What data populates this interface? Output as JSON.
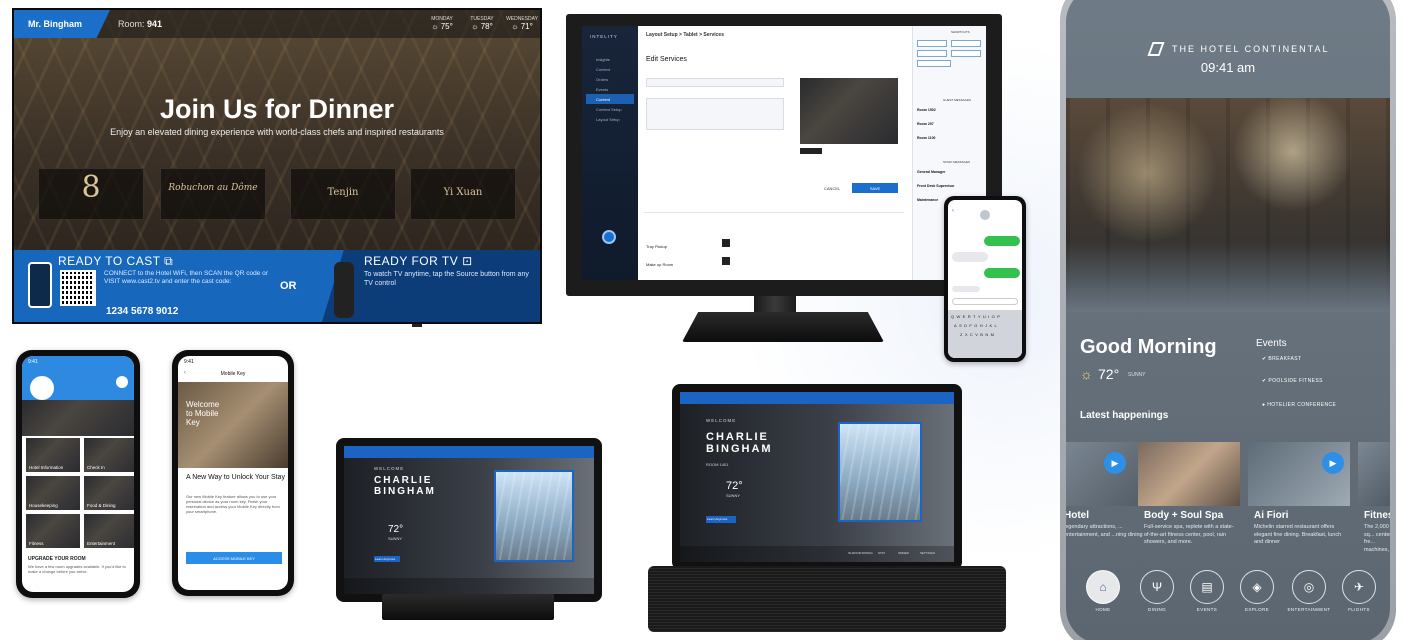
{
  "tv": {
    "guest": "Mr. Bingham",
    "room_label": "Room:",
    "room_number": "941",
    "weather": [
      {
        "day": "MONDAY",
        "temp": "75°"
      },
      {
        "day": "TUESDAY",
        "temp": "78°"
      },
      {
        "day": "WEDNESDAY",
        "temp": "71°"
      }
    ],
    "headline": "Join Us for Dinner",
    "subheadline": "Enjoy an elevated dining experience with world-class chefs and inspired restaurants",
    "restaurants": [
      "8",
      "Robuchon au Dôme",
      "Tenjin",
      "Yi Xuan"
    ],
    "cast_title": "READY TO CAST",
    "cast_text": "CONNECT to the Hotel WiFi, then SCAN the QR code or VISIT www.cast2.tv and enter the cast code:",
    "cast_code": "1234 5678 9012",
    "or": "OR",
    "tv_title": "READY FOR TV",
    "tv_text": "To watch TV anytime, tap the Source button from any TV control"
  },
  "monitor": {
    "brand": "INTELITY",
    "breadcrumb": "Layout Setup > Tablet > Services",
    "page_title": "Edit Services",
    "cancel": "CANCEL",
    "save": "SAVE",
    "sidebar": [
      "Insights",
      "Content",
      "Orders",
      "Events",
      "Content",
      "Content Setup",
      "Layout Setup"
    ],
    "rows": [
      "Tray Pickup",
      "Make up Room"
    ],
    "quick_actions": "SHORTCUTS",
    "guest_messages": "GUEST MESSAGES",
    "staff_messages": "STAFF MESSAGES",
    "guest_items": [
      "Room 1502",
      "Room 207",
      "Room 1100"
    ],
    "staff_items": [
      "General Manager",
      "Front Desk Supervisor",
      "Maintenance"
    ]
  },
  "phone_chat": {
    "messages_count": "3",
    "keyboard_rows": [
      "QWERTYUIOP",
      "ASDFGHJKL",
      "ZXCVBNM"
    ]
  },
  "phone_app1": {
    "time": "9:41",
    "tiles": [
      "Hotel Information",
      "Check In",
      "Housekeeping",
      "Food & Dining",
      "Fitness",
      "Entertainment"
    ],
    "upgrade_title": "UPGRADE YOUR ROOM",
    "upgrade_text": "We have a few room upgrades available. If you'd like to make a change before you arrive."
  },
  "phone_app2": {
    "time": "9:41",
    "title": "Mobile Key",
    "hero_text": "Welcome to Mobile Key",
    "heading": "A New Way to Unlock Your Stay",
    "body": "Our new Mobile Key feature allows you to use your personal device as your room key. Finish your reservation and access your Mobile Key directly from your smartphone.",
    "button": "ACCESS MOBILE KEY"
  },
  "tablet1": {
    "welcome": "WELCOME",
    "name_line1": "CHARLIE",
    "name_line2": "BINGHAM",
    "temp": "72°",
    "cond": "SUNNY",
    "button": "Learn Anymore"
  },
  "tablet2": {
    "welcome": "WELCOME",
    "name_line1": "CHARLIE",
    "name_line2": "BINGHAM",
    "room": "ROOM 1401",
    "temp": "72°",
    "cond": "SUNNY",
    "button": "Learn Anymore",
    "dock": [
      "IN-ROOM DINING",
      "STAY",
      "ORDER",
      "SETTINGS"
    ]
  },
  "bigphone": {
    "brand": "THE HOTEL CONTINENTAL",
    "time": "09:41 am",
    "greeting": "Good Morning",
    "temp": "72°",
    "cond": "SUNNY",
    "events_title": "Events",
    "events": [
      "BREAKFAST",
      "POOLSIDE FITNESS",
      "HOTELIER CONFERENCE"
    ],
    "latest": "Latest happenings",
    "cards": [
      {
        "title": "Hotel",
        "desc": "legendary attractions, ... entertainment, and ...ning dining"
      },
      {
        "title": "Body + Soul Spa",
        "desc": "Full-service spa, replete with a state-of-the-art fitness center, pool, rain showers, and more."
      },
      {
        "title": "Ai Fiori",
        "desc": "Michelin starred restaurant offers elegant fine dining. Breakfast, lunch and dinner"
      },
      {
        "title": "Fitnes",
        "desc": "The 2,000 sq... center, fre... machines, ..."
      }
    ],
    "nav": [
      "HOME",
      "DINING",
      "EVENTS",
      "EXPLORE",
      "ENTERTAINMENT",
      "FLIGHTS"
    ]
  }
}
